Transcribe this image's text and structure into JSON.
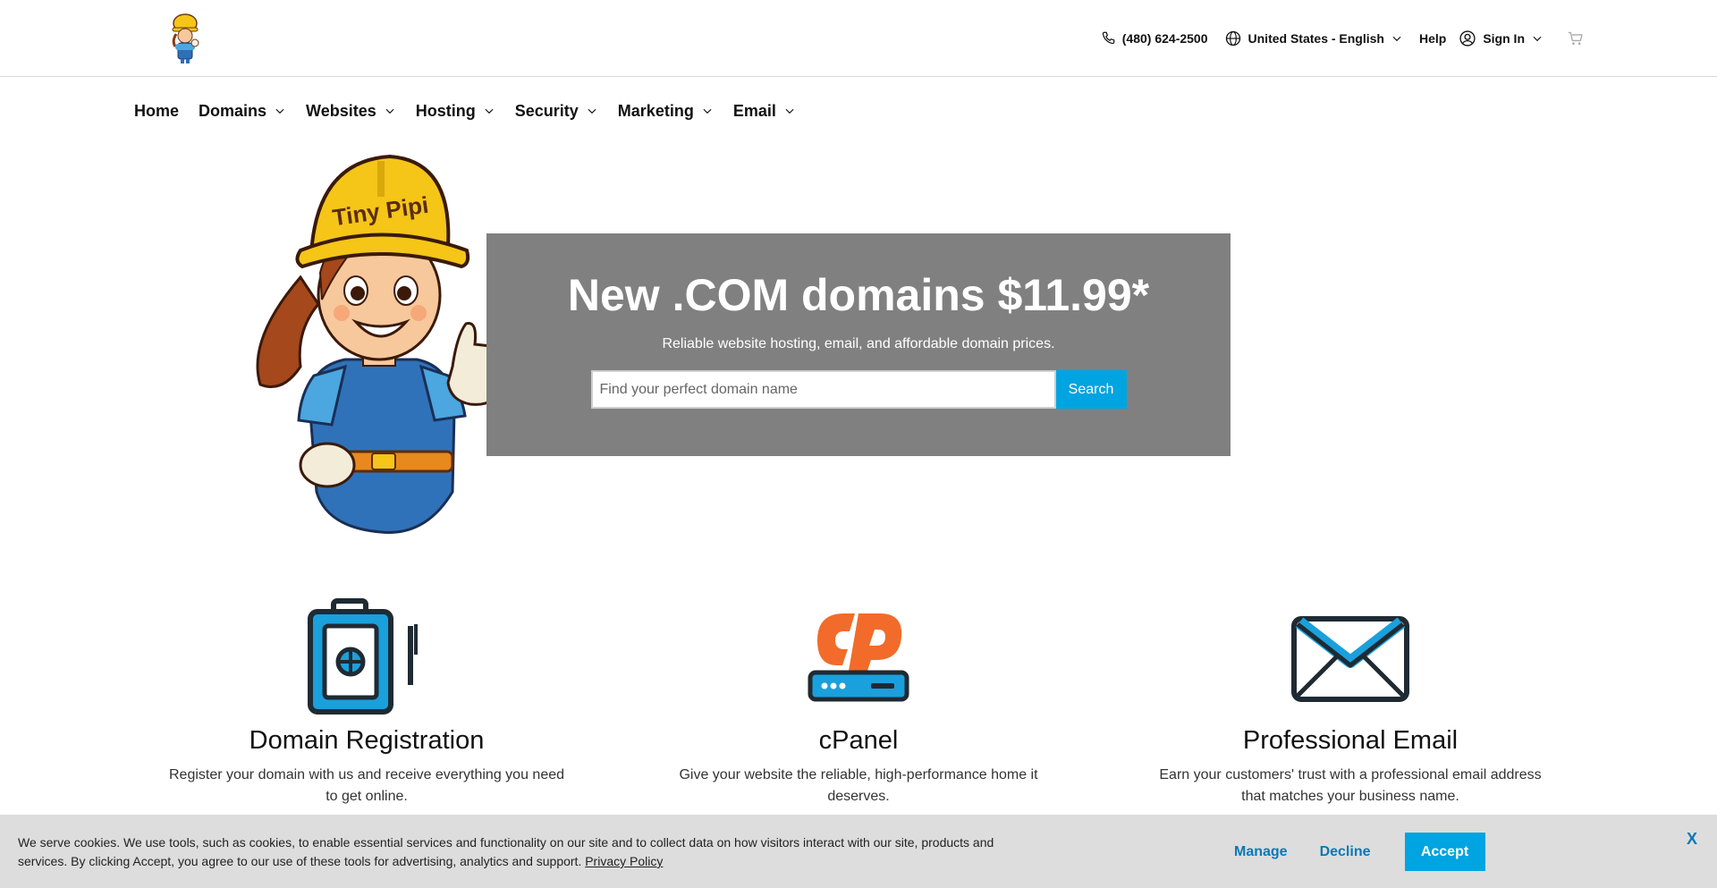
{
  "header": {
    "logo_name": "Tiny Pipi",
    "phone": "(480) 624-2500",
    "locale": "United States - English",
    "help": "Help",
    "sign_in": "Sign In"
  },
  "nav": {
    "items": [
      {
        "label": "Home"
      },
      {
        "label": "Domains"
      },
      {
        "label": "Websites"
      },
      {
        "label": "Hosting"
      },
      {
        "label": "Security"
      },
      {
        "label": "Marketing"
      },
      {
        "label": "Email"
      }
    ]
  },
  "hero": {
    "title": "New .COM domains $11.99*",
    "subtitle": "Reliable website hosting, email, and affordable domain prices.",
    "search_placeholder": "Find your perfect domain name",
    "search_button": "Search",
    "mascot_helmet_text": "Tiny Pipi"
  },
  "features": [
    {
      "title": "Domain Registration",
      "desc": "Register your domain with us and receive everything you need to get online.",
      "icon": "domain-registration-icon"
    },
    {
      "title": "cPanel",
      "desc": "Give your website the reliable, high-performance home it deserves.",
      "icon": "cpanel-icon"
    },
    {
      "title": "Professional Email",
      "desc": "Earn your customers' trust with a professional email address that matches your business name.",
      "icon": "email-envelope-icon"
    }
  ],
  "cookie": {
    "text": "We serve cookies. We use tools, such as cookies, to enable essential services and functionality on our site and to collect data on how visitors interact with our site, products and services. By clicking Accept, you agree to our use of these tools for advertising, analytics and support.",
    "policy_link": "Privacy Policy",
    "manage": "Manage",
    "decline": "Decline",
    "accept": "Accept",
    "close": "X"
  },
  "colors": {
    "accent": "#00a4e0",
    "hero_bg": "#808080",
    "cookie_bg": "#dddddd",
    "link_blue": "#0a78b8",
    "cpanel_orange": "#f26b2a"
  }
}
